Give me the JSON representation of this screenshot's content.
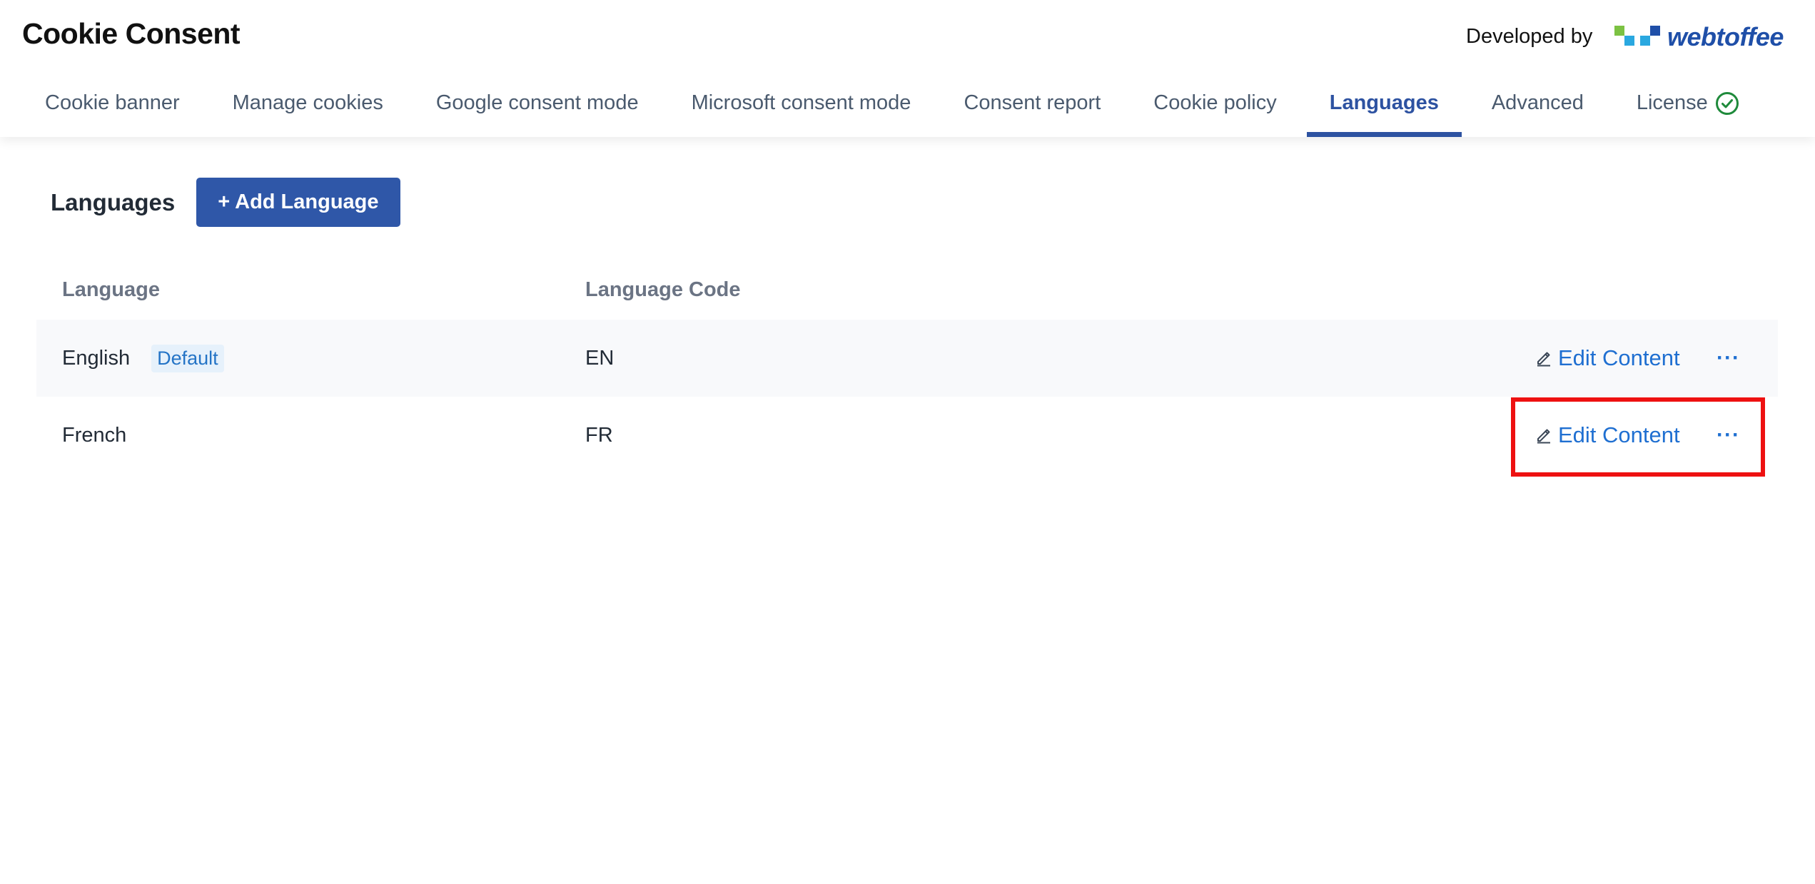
{
  "app": {
    "title": "Cookie Consent",
    "developed_by": "Developed by",
    "brand": "webtoffee"
  },
  "tabs": [
    {
      "label": "Cookie banner"
    },
    {
      "label": "Manage cookies"
    },
    {
      "label": "Google consent mode"
    },
    {
      "label": "Microsoft consent mode"
    },
    {
      "label": "Consent report"
    },
    {
      "label": "Cookie policy"
    },
    {
      "label": "Languages",
      "active": true
    },
    {
      "label": "Advanced"
    },
    {
      "label": "License",
      "icon": "check-circle-icon"
    }
  ],
  "languages_section": {
    "title": "Languages",
    "add_button": "+ Add Language"
  },
  "table": {
    "columns": [
      "Language",
      "Language Code"
    ],
    "rows": [
      {
        "language": "English",
        "badge": "Default",
        "code": "EN",
        "action": "Edit Content",
        "more": "···"
      },
      {
        "language": "French",
        "code": "FR",
        "action": "Edit Content",
        "more": "···"
      }
    ]
  },
  "colors": {
    "accent": "#2d52a1",
    "link": "#1f6fd1",
    "license_ok": "#1f8a3b",
    "highlight": "#ee1111"
  }
}
